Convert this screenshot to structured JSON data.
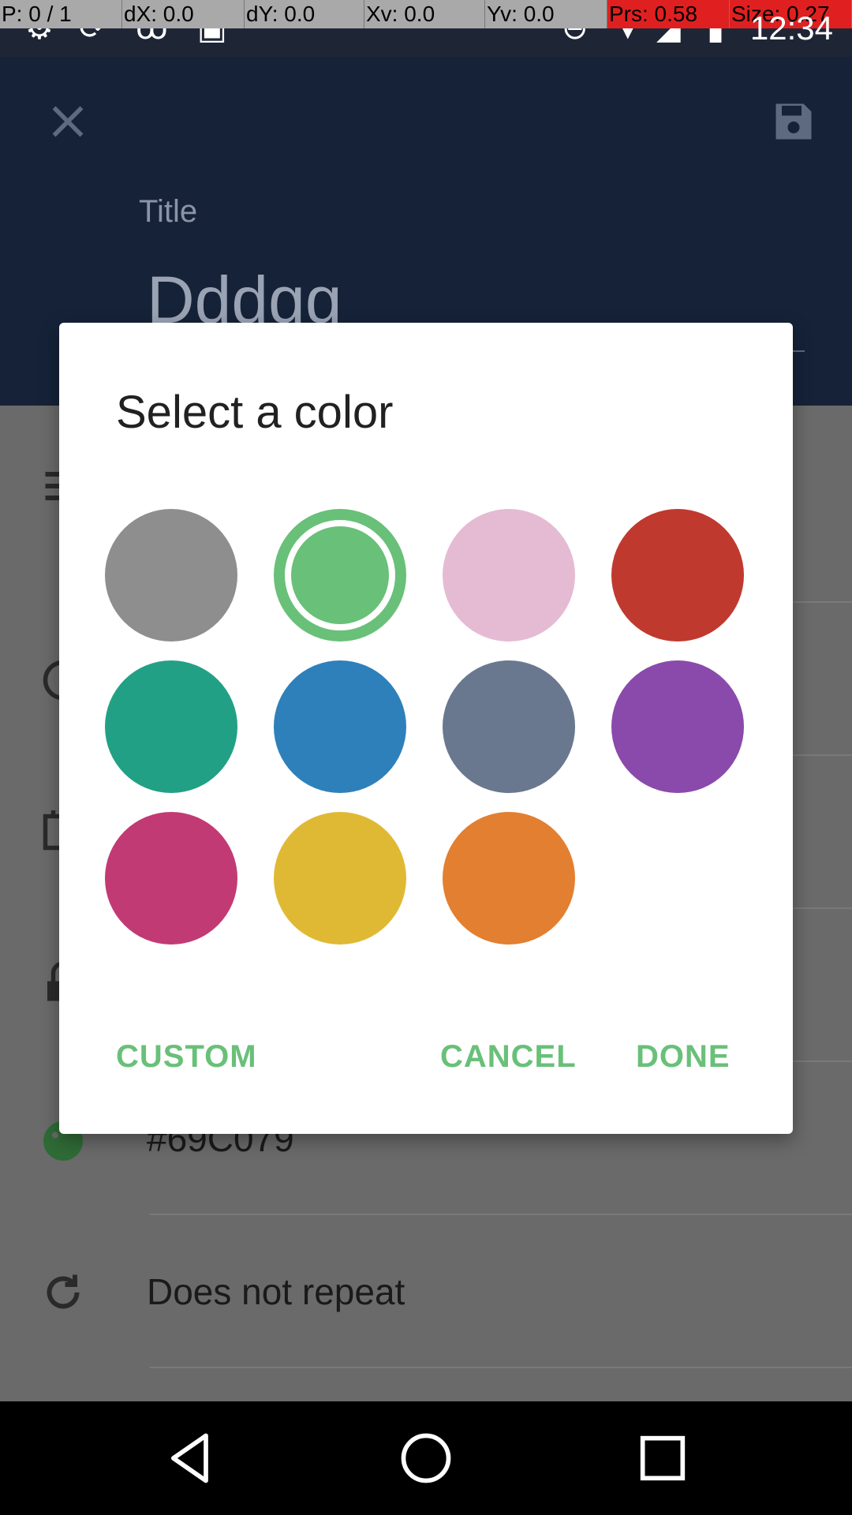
{
  "debug": {
    "p": "P: 0 / 1",
    "dx": "dX: 0.0",
    "dy": "dY: 0.0",
    "xv": "Xv: 0.0",
    "yv": "Yv: 0.0",
    "prs": "Prs: 0.58",
    "size": "Size: 0.27"
  },
  "status": {
    "time": "12:34"
  },
  "header": {
    "field_label": "Title",
    "title_value": "Dddgg"
  },
  "body": {
    "color_value": "#69C079",
    "repeat": "Does not repeat"
  },
  "dialog": {
    "title": "Select a color",
    "swatches": [
      {
        "color": "#8e8e8e",
        "selected": false
      },
      {
        "color": "#69c079",
        "selected": true
      },
      {
        "color": "#e5bbd3",
        "selected": false
      },
      {
        "color": "#c0392f",
        "selected": false
      },
      {
        "color": "#22a085",
        "selected": false
      },
      {
        "color": "#2e80bb",
        "selected": false
      },
      {
        "color": "#69788f",
        "selected": false
      },
      {
        "color": "#8a4aab",
        "selected": false
      },
      {
        "color": "#c23a74",
        "selected": false
      },
      {
        "color": "#e0b934",
        "selected": false
      },
      {
        "color": "#e37f30",
        "selected": false
      }
    ],
    "custom_label": "CUSTOM",
    "cancel_label": "CANCEL",
    "done_label": "DONE"
  },
  "colors": {
    "accent": "#69c079",
    "header_bg": "#152238"
  }
}
